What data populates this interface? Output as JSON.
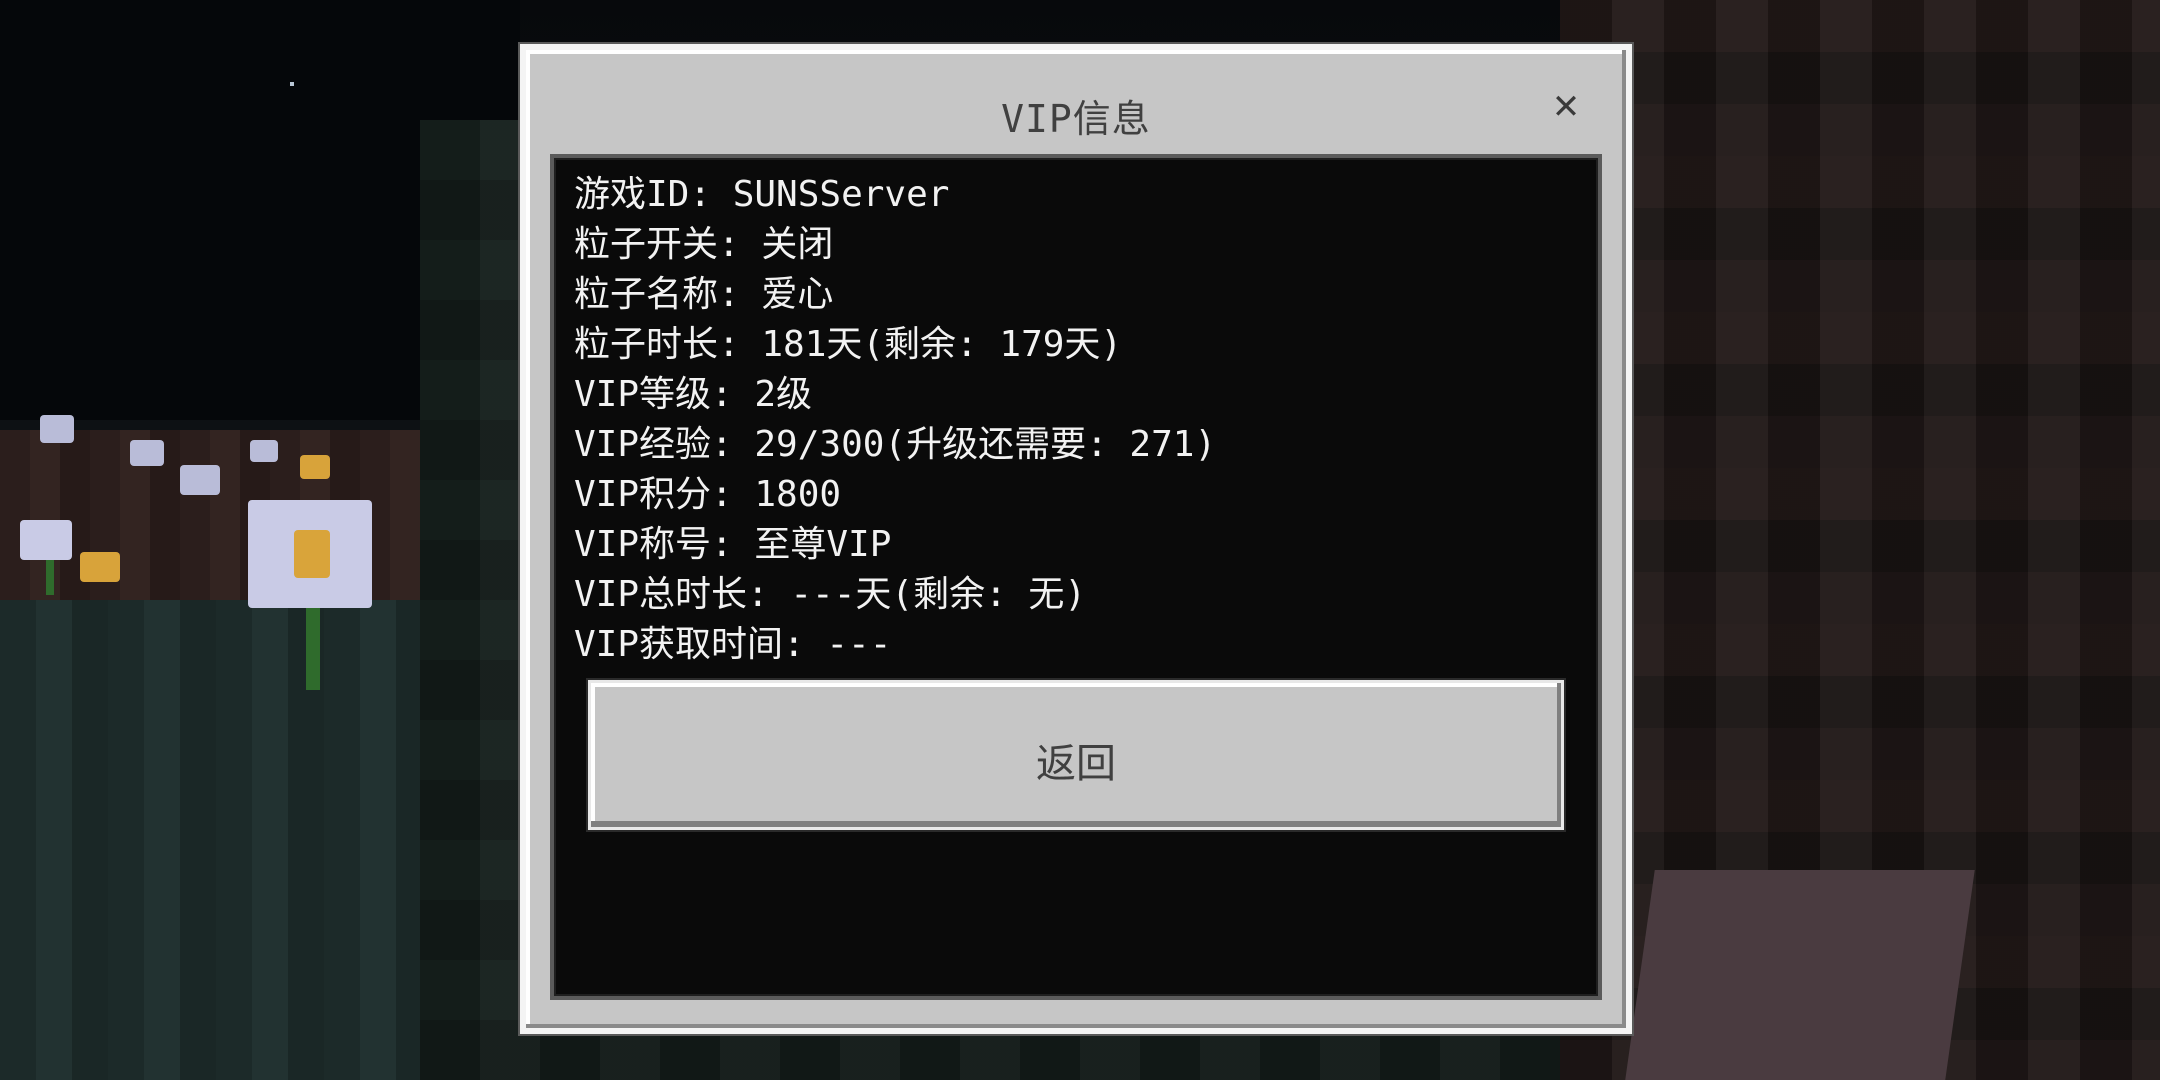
{
  "dialog": {
    "title": "VIP信息",
    "close_icon": "close-icon",
    "info_lines": [
      "游戏ID: SUNSServer",
      "粒子开关: 关闭",
      "粒子名称: 爱心",
      "粒子时长: 181天(剩余: 179天)",
      "VIP等级: 2级",
      "VIP经验: 29/300(升级还需要: 271)",
      "VIP积分: 1800",
      "VIP称号: 至尊VIP",
      "VIP总时长: ---天(剩余: 无)",
      "VIP获取时间: ---"
    ],
    "back_label": "返回"
  },
  "colors": {
    "panel_bg": "#c6c6c6",
    "content_bg": "#0a0a0a",
    "text_light": "#f2f2f2",
    "text_dark": "#404040"
  }
}
